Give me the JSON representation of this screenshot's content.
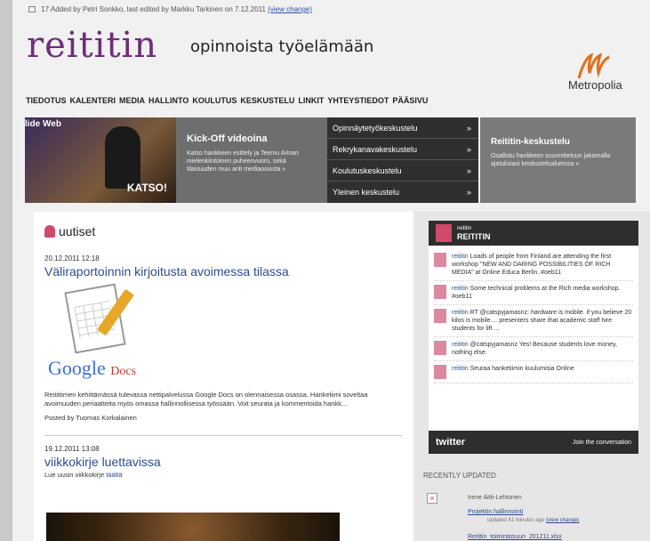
{
  "meta": {
    "text": "17  Added by Petri Sonkko, last edited by Markku Tarkinen on 7.12.2011",
    "view_change": "(view change)"
  },
  "header": {
    "logo": "reititin",
    "tagline": "opinnoista työelämään",
    "partner_logo": "Metropolia"
  },
  "nav": [
    "TIEDOTUS",
    "KALENTERI",
    "MEDIA",
    "HALLINTO",
    "KOULUTUS",
    "KESKUSTELU",
    "LINKIT",
    "YHTEYSTIEDOT",
    "PÄÄSIVU"
  ],
  "banner": {
    "video_label": "lide Web",
    "video_cta": "KATSO!",
    "kickoff_title": "Kick-Off videoina",
    "kickoff_desc": "Katso hankkeen esittely ja Teemu Arinan mielenkiintoinen puheenvuoro, sekä tilaisuuden muu anti mediaosiosta »",
    "menu": [
      "Opinnäytetyökeskustelu",
      "Rekrykanavakeskustelu",
      "Koulutuskeskustelu",
      "Yleinen keskustelu"
    ],
    "menu_arrow": "»",
    "forum_title": "Reititin-keskustelu",
    "forum_desc": "Osallistu hankkeen suunnitteluun jakamalla ajatuksiasi keskustelualueissa »"
  },
  "news": {
    "heading": "uutiset",
    "post1": {
      "date": "20.12.2011 12:18",
      "title": "Väliraportoinnin kirjoitusta avoimessa tilassa",
      "image_brand": "Google",
      "image_product": "Docs",
      "body": "Reitittimen kehittämässä tulevassa nettipalvelussa Google Docs on olennaisessa osassa. Hankeliimi soveltaa avoimuuden periaatteita myös omassa hallinnollisessa työssään. Voit seurata ja kommentoida hankk...",
      "author": "Posted by Tuomas Korkalainen"
    },
    "post2": {
      "date": "19.12.2011 13:08",
      "title": "viikkokirje luettavissa",
      "body_prefix": "Lue uusin viikkokirje ",
      "body_link": "täältä"
    }
  },
  "twitter": {
    "account": "REITITIN",
    "account_small": "reititin",
    "tweets": [
      {
        "user": "reititin",
        "text": "Loads of people from Finland are attending the first workshop \"NEW AND DARING POSSIBILITIES OF RICH MEDIA\" at Online Educa Berlin. #oeb11"
      },
      {
        "user": "reititin",
        "text": "Some technical problems at the Rich media workshop. #oeb11"
      },
      {
        "user": "reititin",
        "text": "RT @catspyjamasnz: hardware is mobile. if you believe 20 kilos is mobile.... presenters share that academic staff hire students for lift ..."
      },
      {
        "user": "reititin",
        "text": "@catspyjamasnz Yes! Because students love money, nothing else."
      },
      {
        "user": "reititin",
        "text": "Seuraa hanketiimin kuulumisia Online"
      }
    ],
    "brand": "twitter",
    "join": "Join the conversation"
  },
  "recently_updated": {
    "heading": "RECENTLY UPDATED",
    "user": "Irene Aitti-Lehtonen",
    "page1": "Projektin hallinnointi",
    "when1": "updated 41 minutes ago",
    "view_change": "(view change)",
    "page2": "Reititin_toimintasuun_201211.xlsx"
  }
}
